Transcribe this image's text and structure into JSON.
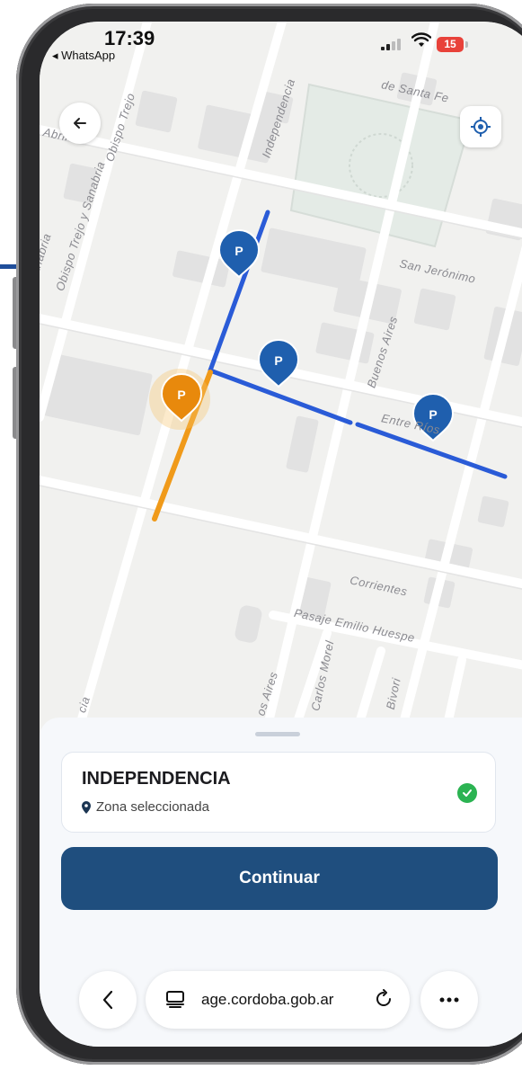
{
  "status_bar": {
    "time": "17:39",
    "back_app": "◂ WhatsApp",
    "battery": "15",
    "battery_color": "#e8423a"
  },
  "map": {
    "streets": {
      "santa_fe": "de Santa Fe",
      "independencia": "Independencia",
      "obispo_trejo_top": "Obispo Trejo",
      "obispo_trejo_sanabria": "Obispo Trejo y Sanabria",
      "obispos_trejo_left": "Obispo Trejo y Sanabria",
      "san_jeronimo": "San Jerónimo",
      "buenos_aires": "Buenos Aires",
      "entre_rios": "Entre Ríos",
      "corrientes": "Corrientes",
      "pasaje": "Pasaje Emilio Huespe",
      "carlos_morel": "Carlos Morel",
      "buenos_aires_bottom": "os Aires",
      "bivori": "Bivori",
      "abril": "Abril",
      "cia": "cia"
    },
    "markers": [
      {
        "label": "P",
        "selected": false
      },
      {
        "label": "P",
        "selected": false
      },
      {
        "label": "P",
        "selected": true
      },
      {
        "label": "P",
        "selected": false
      }
    ],
    "colors": {
      "available_zone": "#2a5bd7",
      "selected_zone": "#f09a1a",
      "marker_blue": "#1f5fae",
      "marker_orange": "#e8890c"
    }
  },
  "sheet": {
    "zone_name": "INDEPENDENCIA",
    "zone_status": "Zona seleccionada",
    "continue_label": "Continuar"
  },
  "browser": {
    "url": "age.cordoba.gob.ar"
  }
}
